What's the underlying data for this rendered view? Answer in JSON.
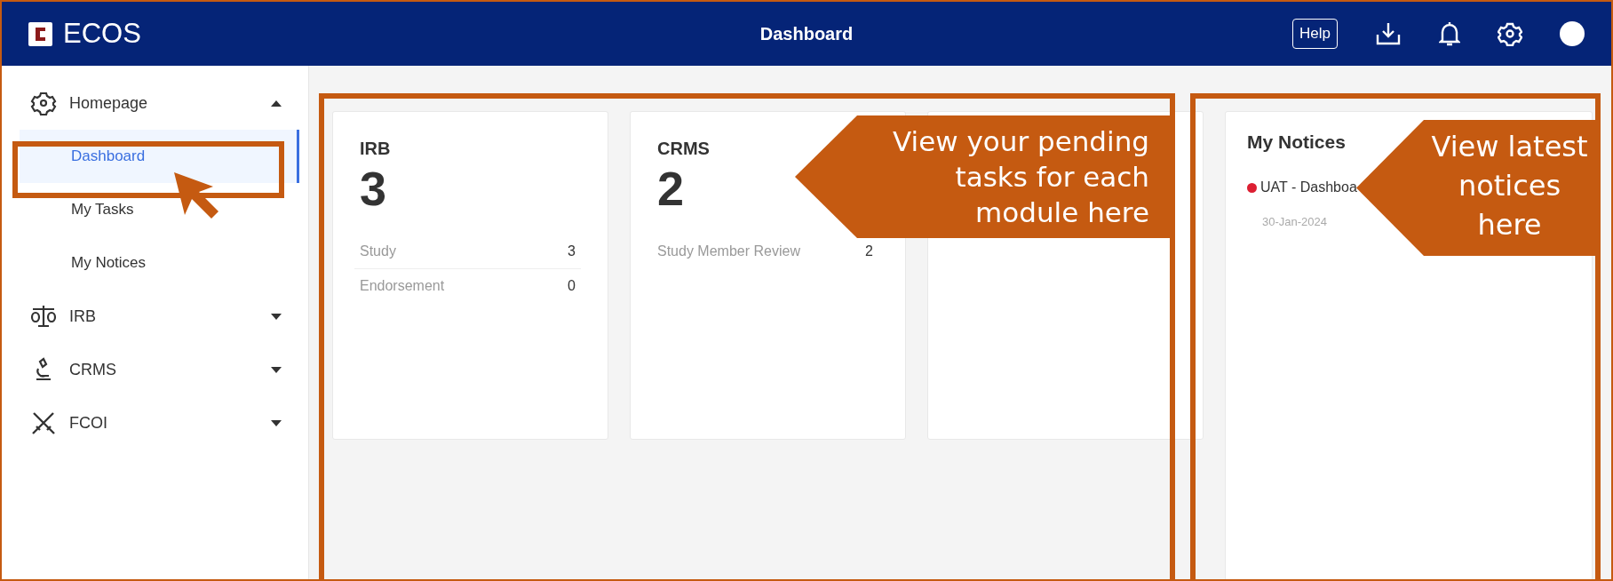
{
  "header": {
    "logo_text": "ECOS",
    "title": "Dashboard",
    "help": "Help"
  },
  "sidebar": {
    "items": [
      {
        "label": "Homepage",
        "expanded": true,
        "children": [
          {
            "label": "Dashboard",
            "selected": true
          },
          {
            "label": "My Tasks",
            "selected": false
          },
          {
            "label": "My Notices",
            "selected": false
          }
        ]
      },
      {
        "label": "IRB",
        "expanded": false
      },
      {
        "label": "CRMS",
        "expanded": false
      },
      {
        "label": "FCOI",
        "expanded": false
      }
    ]
  },
  "cards": [
    {
      "kind": "module",
      "title": "IRB",
      "count": "3",
      "rows": [
        {
          "label": "Study",
          "value": "3"
        },
        {
          "label": "Endorsement",
          "value": "0"
        }
      ]
    },
    {
      "kind": "module",
      "title": "CRMS",
      "count": "2",
      "rows": [
        {
          "label": "Study Member Review",
          "value": "2"
        }
      ]
    },
    {
      "kind": "covered"
    }
  ],
  "notices": {
    "title": "My Notices",
    "items": [
      {
        "title": "UAT - Dashboa",
        "date": "30-Jan-2024",
        "unread": true
      }
    ]
  },
  "callouts": [
    {
      "kind": "modules",
      "text": "View your pending tasks for each module here"
    },
    {
      "kind": "notices",
      "text": "View latest notices here"
    }
  ]
}
